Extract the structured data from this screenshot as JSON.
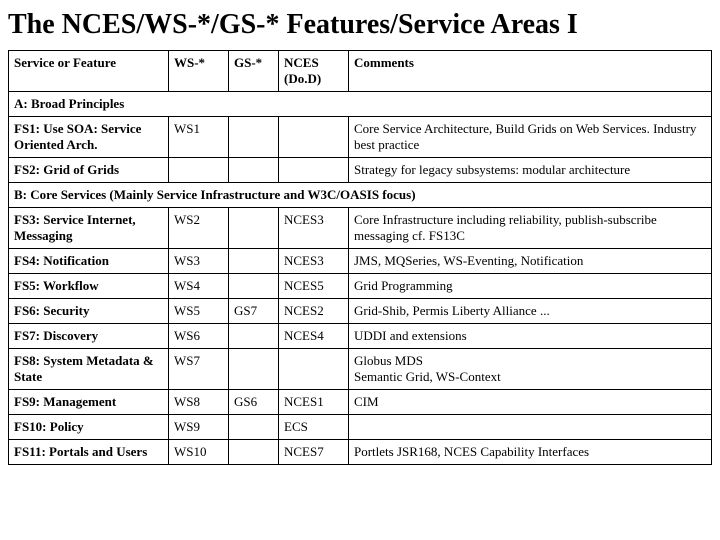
{
  "title": "The NCES/WS-*/GS-* Features/Service Areas I",
  "table": {
    "headers": [
      "Service or Feature",
      "WS-*",
      "GS-*",
      "NCES (Do.D)",
      "Comments"
    ],
    "sections": [
      {
        "type": "section-header",
        "label": "A: Broad Principles",
        "colspan": 5
      },
      {
        "type": "row",
        "service": "FS1: Use SOA: Service Oriented Arch.",
        "ws": "WS1",
        "gs": "",
        "nces": "",
        "comments": "Core Service Architecture, Build Grids on Web Services. Industry best practice"
      },
      {
        "type": "row",
        "service": "FS2: Grid of Grids",
        "ws": "",
        "gs": "",
        "nces": "",
        "comments": "Strategy for legacy subsystems: modular architecture"
      },
      {
        "type": "section-header",
        "label": "B: Core Services (Mainly Service Infrastructure and W3C/OASIS focus)",
        "colspan": 5
      },
      {
        "type": "row",
        "service": "FS3: Service Internet, Messaging",
        "ws": "WS2",
        "gs": "",
        "nces": "NCES3",
        "comments": "Core Infrastructure including reliability, publish-subscribe messaging cf. FS13C"
      },
      {
        "type": "row",
        "service": "FS4: Notification",
        "ws": "WS3",
        "gs": "",
        "nces": "NCES3",
        "comments": "JMS, MQSeries, WS-Eventing, Notification"
      },
      {
        "type": "row",
        "service": "FS5: Workflow",
        "ws": "WS4",
        "gs": "",
        "nces": "NCES5",
        "comments": "Grid Programming"
      },
      {
        "type": "row",
        "service": "FS6: Security",
        "ws": "WS5",
        "gs": "GS7",
        "nces": "NCES2",
        "comments": "Grid-Shib, Permis Liberty Alliance ..."
      },
      {
        "type": "row",
        "service": "FS7: Discovery",
        "ws": "WS6",
        "gs": "",
        "nces": "NCES4",
        "comments": "UDDI and extensions"
      },
      {
        "type": "row",
        "service": "FS8: System Metadata & State",
        "ws": "WS7",
        "gs": "",
        "nces": "",
        "comments": "Globus MDS\nSemantic Grid, WS-Context"
      },
      {
        "type": "row",
        "service": "FS9: Management",
        "ws": "WS8",
        "gs": "GS6",
        "nces": "NCES1",
        "comments": "CIM"
      },
      {
        "type": "row",
        "service": "FS10: Policy",
        "ws": "WS9",
        "gs": "",
        "nces": "ECS",
        "comments": ""
      },
      {
        "type": "row",
        "service": "FS11: Portals and Users",
        "ws": "WS10",
        "gs": "",
        "nces": "NCES7",
        "comments": "Portlets JSR168, NCES Capability Interfaces"
      }
    ]
  }
}
